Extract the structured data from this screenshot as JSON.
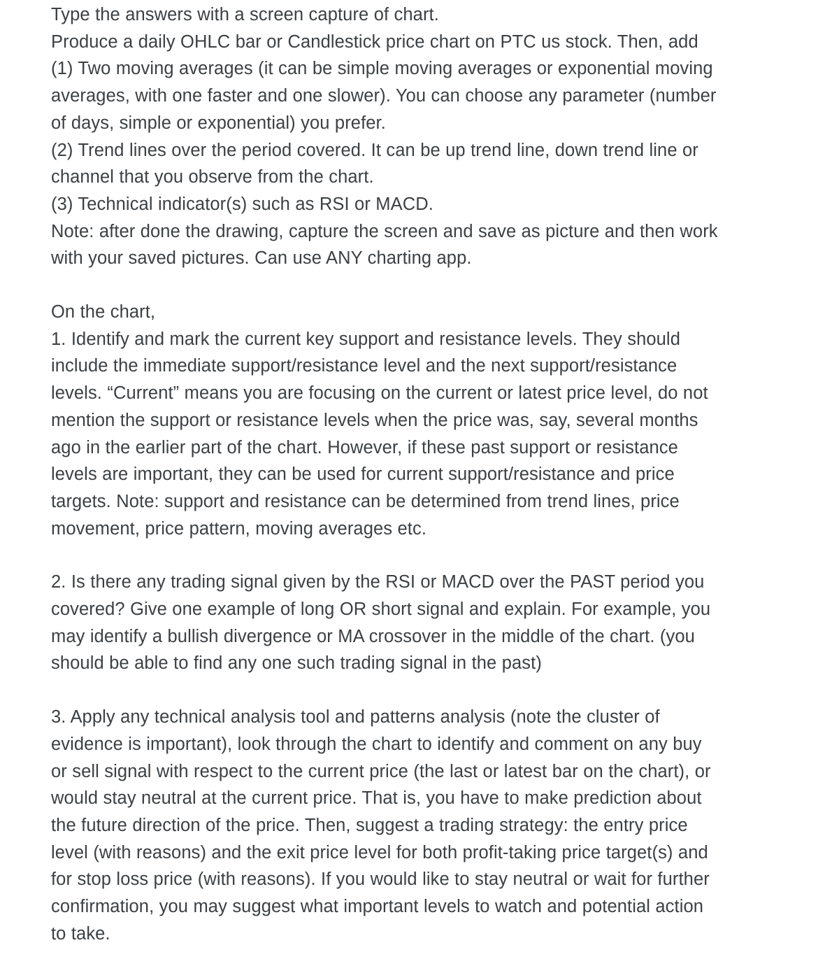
{
  "document": {
    "background_color": "#ffffff",
    "text_color": "#3c4043",
    "blocks": [
      {
        "id": "instructions",
        "lines": [
          "Type the answers with a screen capture of chart.",
          "Produce a daily OHLC bar or Candlestick price chart on PTC us stock. Then, add",
          "(1) Two moving averages (it can be simple moving averages or exponential moving",
          "averages, with one faster and one slower). You can choose any parameter (number",
          "of days, simple or exponential) you prefer.",
          "(2) Trend lines over the period covered. It can be up trend line, down trend line or",
          "channel that you observe from the chart.",
          "(3) Technical indicator(s) such as RSI or MACD.",
          "Note: after done the drawing, capture the screen and save as picture and then work",
          "with your saved pictures. Can use ANY charting app."
        ]
      },
      {
        "id": "question-1",
        "lines": [
          "On the chart,",
          "1. Identify and mark the current key support and resistance levels. They should",
          "include the immediate support/resistance level and the next support/resistance",
          "levels. “Current” means you are focusing on the current or latest price level, do not",
          "mention the support or resistance levels when the price was, say, several months",
          "ago in the earlier part of the chart. However, if these past support or resistance",
          "levels are important, they can be used for current support/resistance and price",
          "targets. Note: support and resistance can be determined from trend lines, price",
          "movement, price pattern, moving averages etc."
        ]
      },
      {
        "id": "question-2",
        "lines": [
          "2. Is there any trading signal given by the RSI or MACD over the PAST period you",
          "covered? Give one example of long OR short signal and explain. For example, you",
          "may identify a bullish divergence or MA crossover in the middle of the chart. (you",
          "should be able to find any one such trading signal in the past)"
        ]
      },
      {
        "id": "question-3",
        "lines": [
          "3. Apply any technical analysis tool and patterns analysis (note the cluster of",
          "evidence is important), look through the chart to identify and comment on any buy",
          "or sell signal with respect to the current price (the last or latest bar on the chart), or",
          "would stay neutral at the current price. That is, you have to make prediction about",
          "the future direction of the price. Then, suggest a trading strategy: the entry price",
          "level (with reasons) and the exit price level for both profit-taking price target(s) and",
          "for stop loss price (with reasons). If you would like to stay neutral or wait for further",
          "confirmation, you may suggest what important levels to watch and potential action",
          "to take."
        ]
      }
    ]
  }
}
